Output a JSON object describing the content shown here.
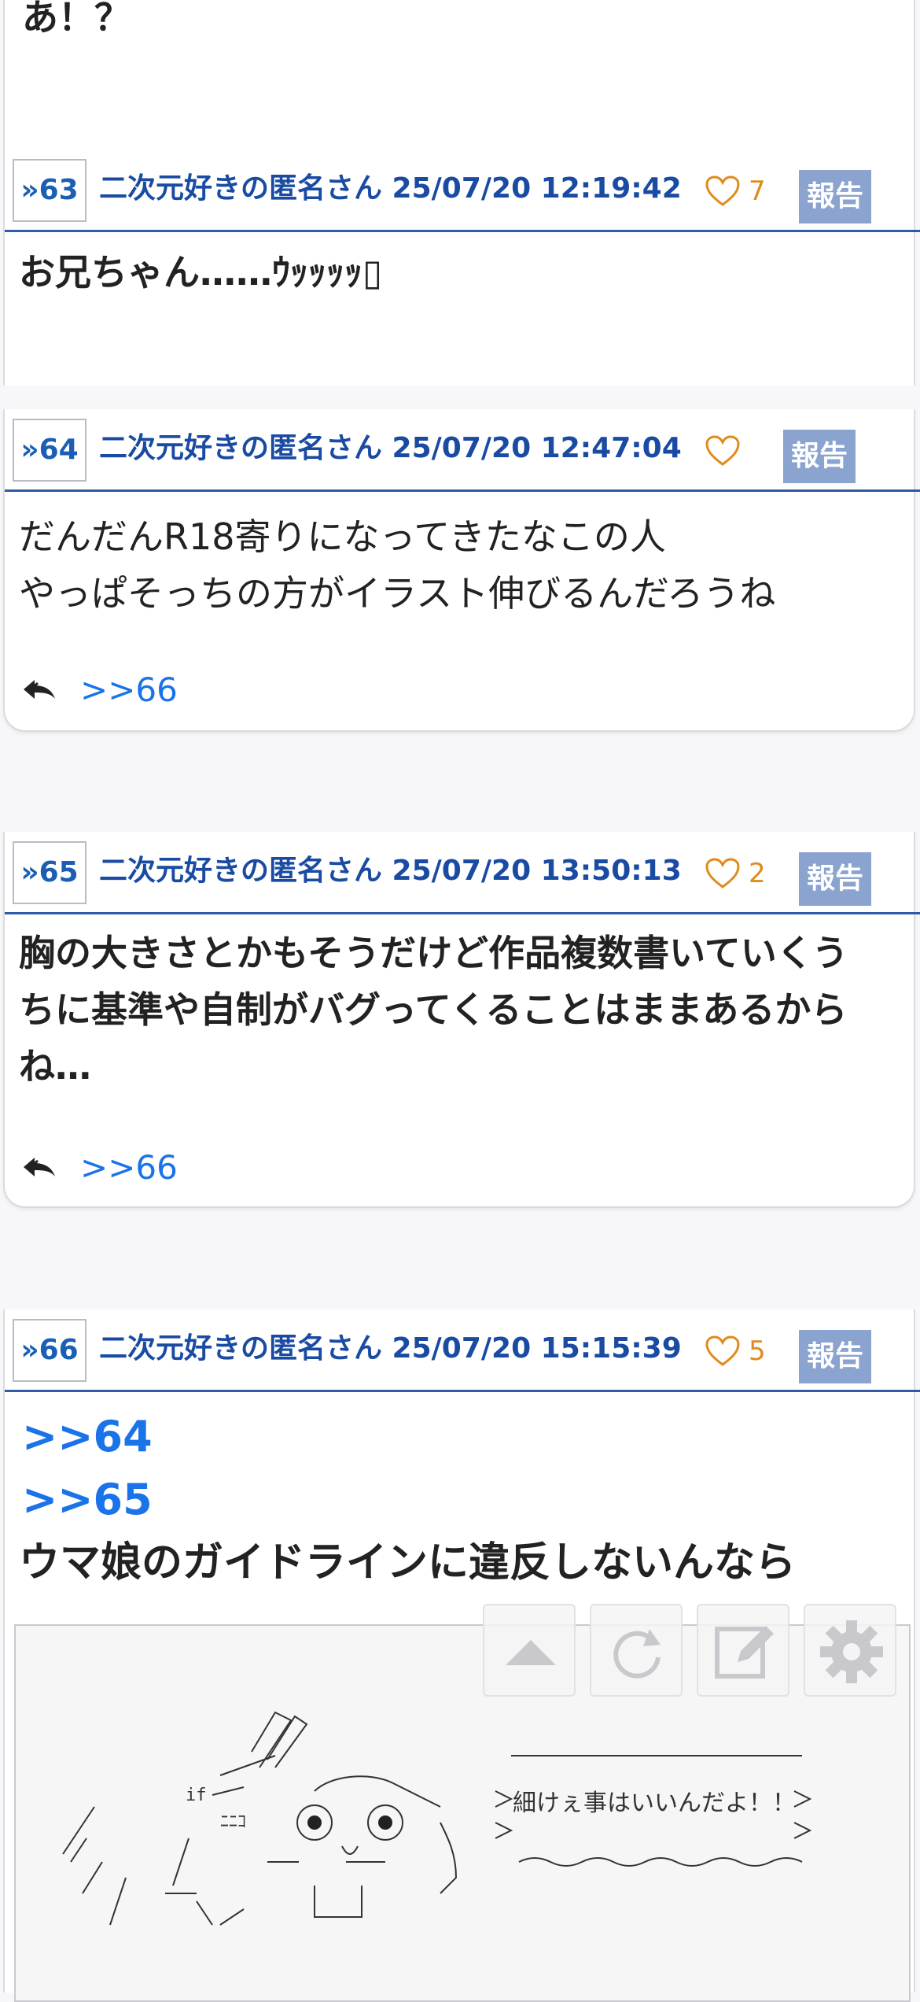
{
  "top_fragment": "あ！？",
  "posts": [
    {
      "num": "»63",
      "author_line": "二次元好きの匿名さん 25/07/20 12:19:42",
      "likes": "7",
      "report": "報告",
      "body": [
        "お兄ちゃん……ｳｯｯｯｯ▯"
      ]
    },
    {
      "num": "»64",
      "author_line": "二次元好きの匿名さん 25/07/20 12:47:04",
      "likes": "",
      "report": "報告",
      "body": [
        "だんだんR18寄りになってきたなこの人",
        "やっぱそっちの方がイラスト伸びるんだろうね"
      ],
      "reply": ">>66"
    },
    {
      "num": "»65",
      "author_line": "二次元好きの匿名さん 25/07/20 13:50:13",
      "likes": "2",
      "report": "報告",
      "body": [
        "胸の大きさとかもそうだけど作品複数書いていくう",
        "ちに基準や自制がバグってくることはままあるから",
        "ね…"
      ],
      "reply": ">>66"
    },
    {
      "num": "»66",
      "author_line": "二次元好きの匿名さん 25/07/20 15:15:39",
      "likes": "5",
      "report": "報告",
      "anchors": [
        ">>64",
        ">>65"
      ],
      "body": [
        "ウマ娘のガイドラインに違反しないんなら"
      ],
      "image_text": "細けぇ事はいいんだよ！！"
    }
  ],
  "colors": {
    "accent": "#1a4ba3",
    "link": "#1a73e8",
    "like": "#e08a1e",
    "report_bg": "#8aa3cf",
    "rule": "#2e5aa6"
  },
  "fab_icons": [
    "arrow-up-icon",
    "refresh-icon",
    "edit-icon",
    "gear-icon"
  ]
}
